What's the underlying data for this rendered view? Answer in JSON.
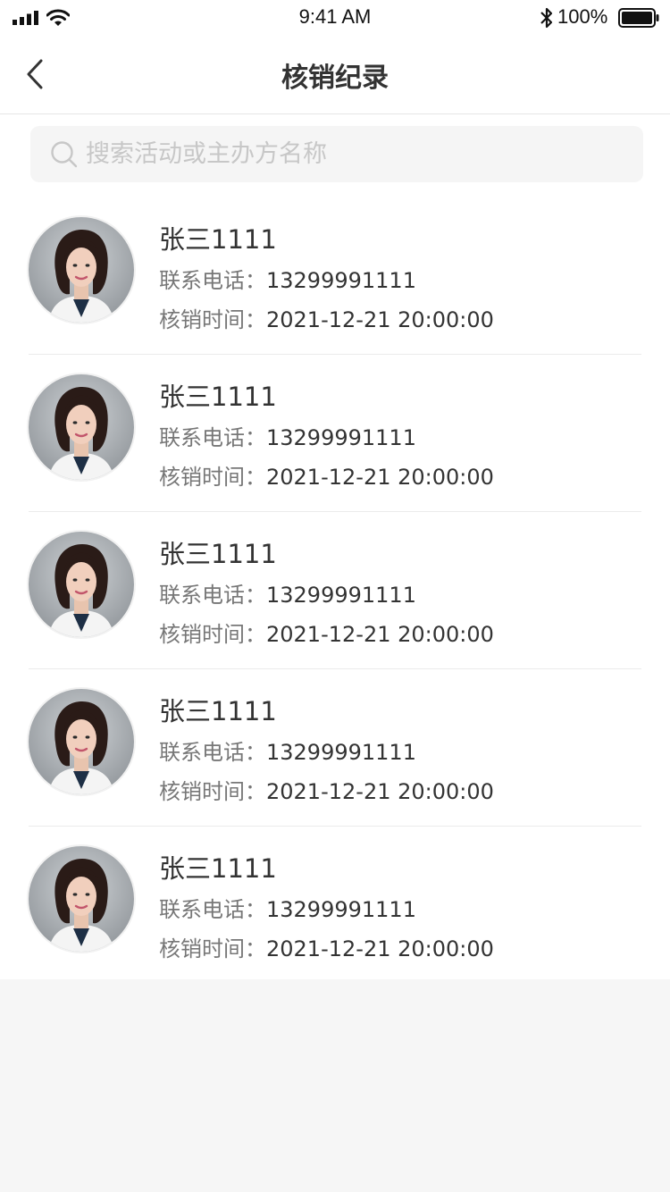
{
  "status_bar": {
    "time": "9:41 AM",
    "battery": "100%",
    "icons": [
      "signal-icon",
      "wifi-icon",
      "bluetooth-icon",
      "battery-icon"
    ]
  },
  "nav": {
    "title": "核销纪录",
    "back_icon": "chevron-left-icon"
  },
  "search": {
    "placeholder": "搜索活动或主办方名称",
    "value": "",
    "icon": "search-icon"
  },
  "labels": {
    "phone": "联系电话：",
    "time": "核销时间："
  },
  "records": [
    {
      "name": "张三1111",
      "phone": "13299991111",
      "time": "2021-12-21 20:00:00"
    },
    {
      "name": "张三1111",
      "phone": "13299991111",
      "time": "2021-12-21 20:00:00"
    },
    {
      "name": "张三1111",
      "phone": "13299991111",
      "time": "2021-12-21 20:00:00"
    },
    {
      "name": "张三1111",
      "phone": "13299991111",
      "time": "2021-12-21 20:00:00"
    },
    {
      "name": "张三1111",
      "phone": "13299991111",
      "time": "2021-12-21 20:00:00"
    }
  ],
  "colors": {
    "background": "#f6f6f6",
    "surface": "#ffffff",
    "text_primary": "#333333",
    "text_secondary": "#777777",
    "placeholder": "#c7c7c7"
  }
}
